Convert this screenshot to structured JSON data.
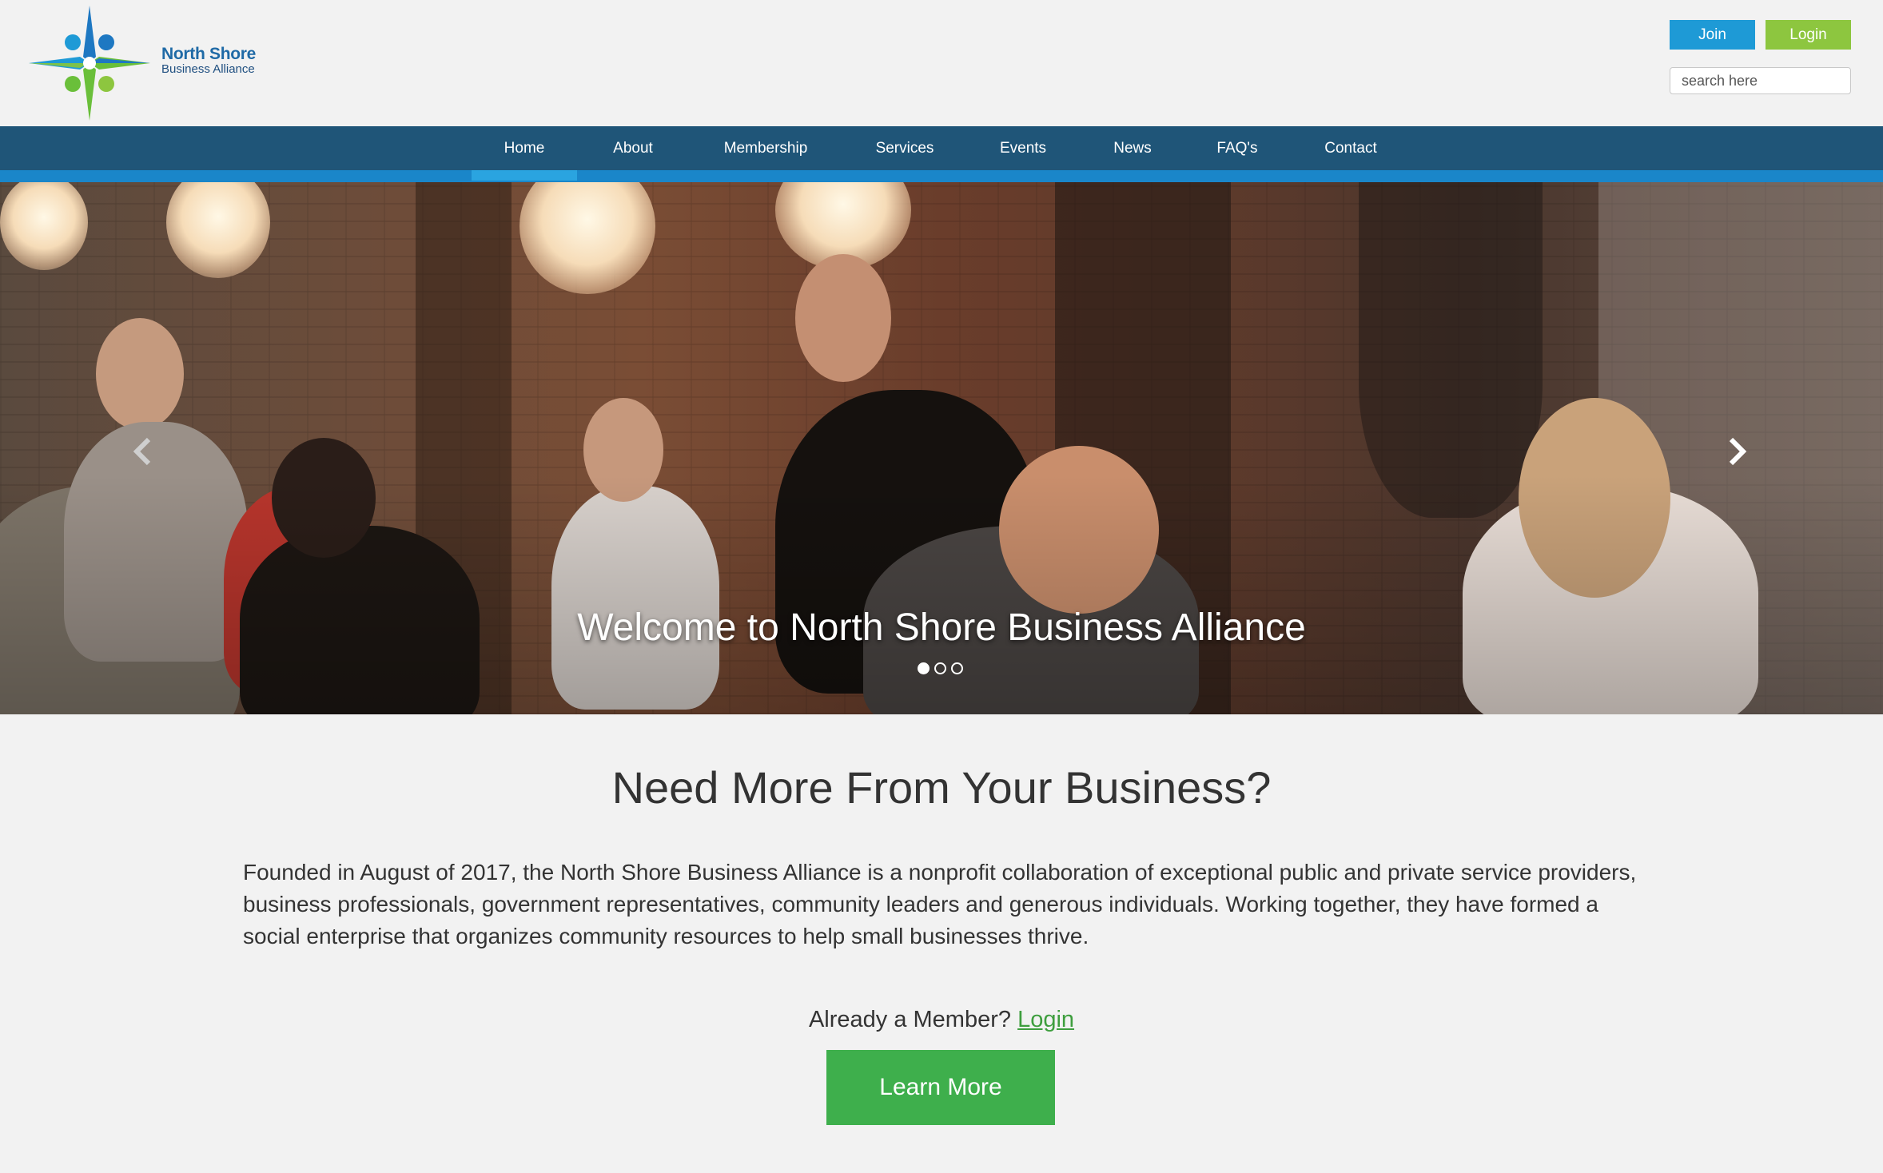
{
  "brand": {
    "name": "North Shore",
    "subtitle": "Business Alliance",
    "colors": {
      "blue": "#1e9ad6",
      "green": "#8dc63f",
      "navy": "#1f5578"
    }
  },
  "header": {
    "join_label": "Join",
    "login_label": "Login",
    "search_placeholder": "search here"
  },
  "nav": {
    "items": [
      {
        "label": "Home",
        "active": true
      },
      {
        "label": "About"
      },
      {
        "label": "Membership"
      },
      {
        "label": "Services"
      },
      {
        "label": "Events"
      },
      {
        "label": "News"
      },
      {
        "label": "FAQ's"
      },
      {
        "label": "Contact"
      }
    ]
  },
  "hero": {
    "caption": "Welcome to North Shore Business Alliance",
    "slides_total": 3,
    "active_slide": 1,
    "prev_icon": "chevron-left-icon",
    "next_icon": "chevron-right-icon"
  },
  "main": {
    "heading": "Need More From Your Business?",
    "intro": "Founded in August of 2017, the North Shore Business Alliance is a nonprofit collaboration of exceptional public and private service providers, business professionals, government representatives, community leaders and generous individuals. Working together, they have formed a social enterprise that organizes community resources to help small businesses thrive.",
    "member_prompt": "Already a Member?",
    "member_login": "Login",
    "cta_label": "Learn More",
    "cta_color": "#3eaf4c"
  }
}
